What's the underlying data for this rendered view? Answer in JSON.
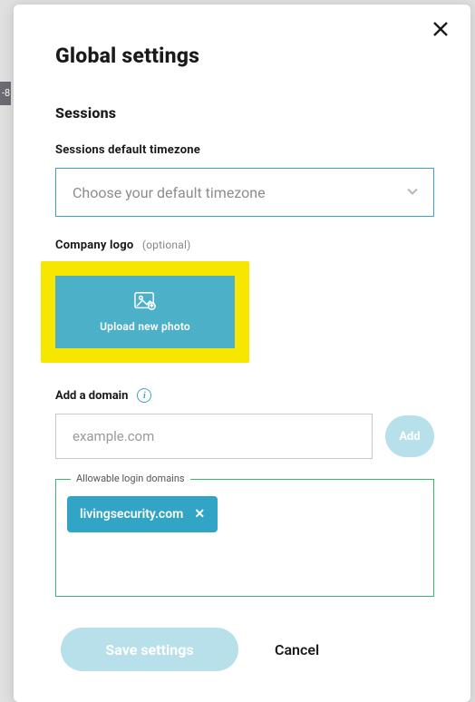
{
  "bg_fragment": "-8",
  "modal": {
    "title": "Global settings",
    "sections": {
      "sessions": {
        "heading": "Sessions",
        "timezone_label": "Sessions default timezone",
        "timezone_placeholder": "Choose your default timezone"
      },
      "company_logo": {
        "label": "Company logo",
        "optional": "(optional)",
        "upload_label": "Upload new photo"
      },
      "domain": {
        "label": "Add a domain",
        "input_placeholder": "example.com",
        "add_button": "Add",
        "fieldset_legend": "Allowable login domains",
        "chips": [
          "livingsecurity.com"
        ]
      }
    },
    "actions": {
      "save": "Save settings",
      "cancel": "Cancel"
    }
  }
}
